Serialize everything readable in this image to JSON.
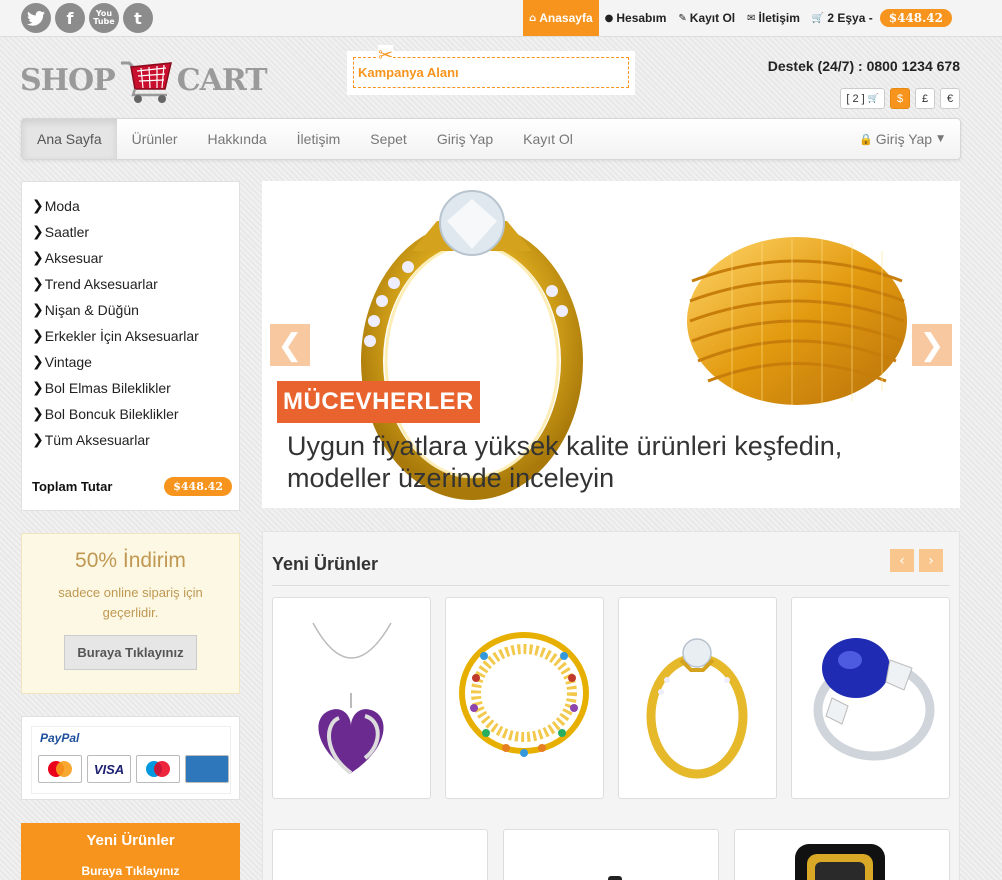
{
  "social": [
    {
      "name": "twitter-icon",
      "glyph": "t"
    },
    {
      "name": "facebook-icon",
      "glyph": "f"
    },
    {
      "name": "youtube-icon",
      "glyph": "You Tube"
    },
    {
      "name": "tumblr-icon",
      "glyph": "t"
    }
  ],
  "topnav": {
    "home": "Anasayfa",
    "account": "Hesabım",
    "register": "Kayıt Ol",
    "contact": "İletişim",
    "cart": "2 Eşya -",
    "cart_total": "$448.42"
  },
  "logo": {
    "left": "SHOP",
    "right": "CART"
  },
  "campaign": "Kampanya Alanı",
  "support": "Destek (24/7) : 0800 1234 678",
  "currency": {
    "cart_count": "[ 2 ]",
    "usd": "$",
    "gbp": "£",
    "eur": "€"
  },
  "mainnav": {
    "items": [
      "Ana Sayfa",
      "Ürünler",
      "Hakkında",
      "İletişim",
      "Sepet",
      "Giriş Yap",
      "Kayıt Ol"
    ],
    "login_dropdown": "Giriş Yap"
  },
  "categories": [
    "Moda",
    "Saatler",
    "Aksesuar",
    "Trend Aksesuarlar",
    "Nişan & Düğün",
    "Erkekler İçin Aksesuarlar",
    "Vintage",
    "Bol Elmas Bileklikler",
    "Bol Boncuk Bileklikler",
    "Tüm Aksesuarlar"
  ],
  "total": {
    "label": "Toplam Tutar",
    "value": "$448.42"
  },
  "promo": {
    "heading": "50% İndirim",
    "text": "sadece online sipariş için geçerlidir.",
    "button": "Buraya Tıklayınız"
  },
  "payment": {
    "brand": "PayPal",
    "cards": [
      "MasterCard",
      "VISA",
      "Maestro",
      "AMEX"
    ]
  },
  "newbox": {
    "heading": "Yeni Ürünler",
    "sub": "Buraya Tıklayınız"
  },
  "slider": {
    "caption": "MÜCEVHERLER",
    "text_line1": "Uygun fiyatlara yüksek kalite ürünleri keşfedin,",
    "text_line2": "modeller üzerinde inceleyin",
    "prev": "❮",
    "next": "❯"
  },
  "products": {
    "title": "Yeni Ürünler",
    "prev": "‹",
    "next": "›"
  },
  "colors": {
    "accent": "#f7941d",
    "caption": "#e8632e",
    "gold": "#e2b21c"
  }
}
